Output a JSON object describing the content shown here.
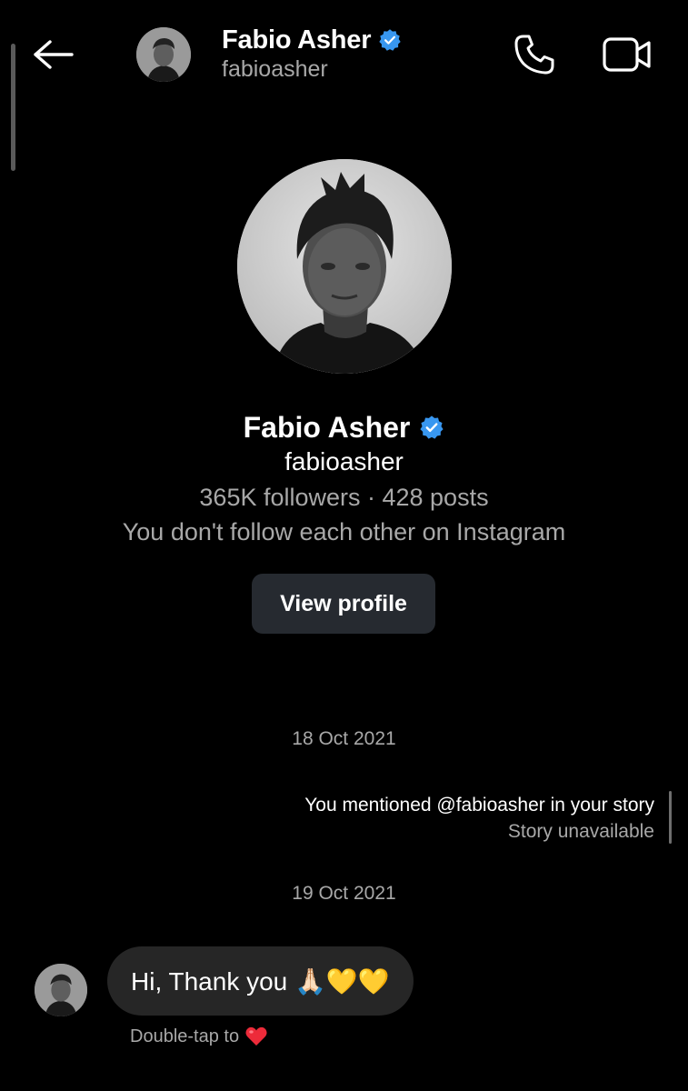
{
  "header": {
    "name": "Fabio Asher",
    "username": "fabioasher"
  },
  "profile": {
    "name": "Fabio Asher",
    "username": "fabioasher",
    "stats": "365K followers · 428 posts",
    "relation": "You don't follow each other on Instagram",
    "view_profile_label": "View profile"
  },
  "chat": {
    "date1": "18 Oct 2021",
    "mention_text": "You mentioned @fabioasher in your story",
    "mention_sub": "Story unavailable",
    "date2": "19 Oct 2021",
    "message_text": "Hi, Thank you 🙏🏻💛💛",
    "double_tap_hint": "Double-tap to"
  },
  "colors": {
    "background": "#000000",
    "verified_blue": "#3897f0",
    "button_bg": "#262a30",
    "bubble_bg": "#262626",
    "secondary_text": "#a8a8a8",
    "heart_red": "#ed2b3a"
  },
  "icons": {
    "back": "arrow-left-icon",
    "call": "phone-icon",
    "video": "video-camera-icon",
    "verified": "verified-badge-icon",
    "heart": "heart-icon"
  }
}
